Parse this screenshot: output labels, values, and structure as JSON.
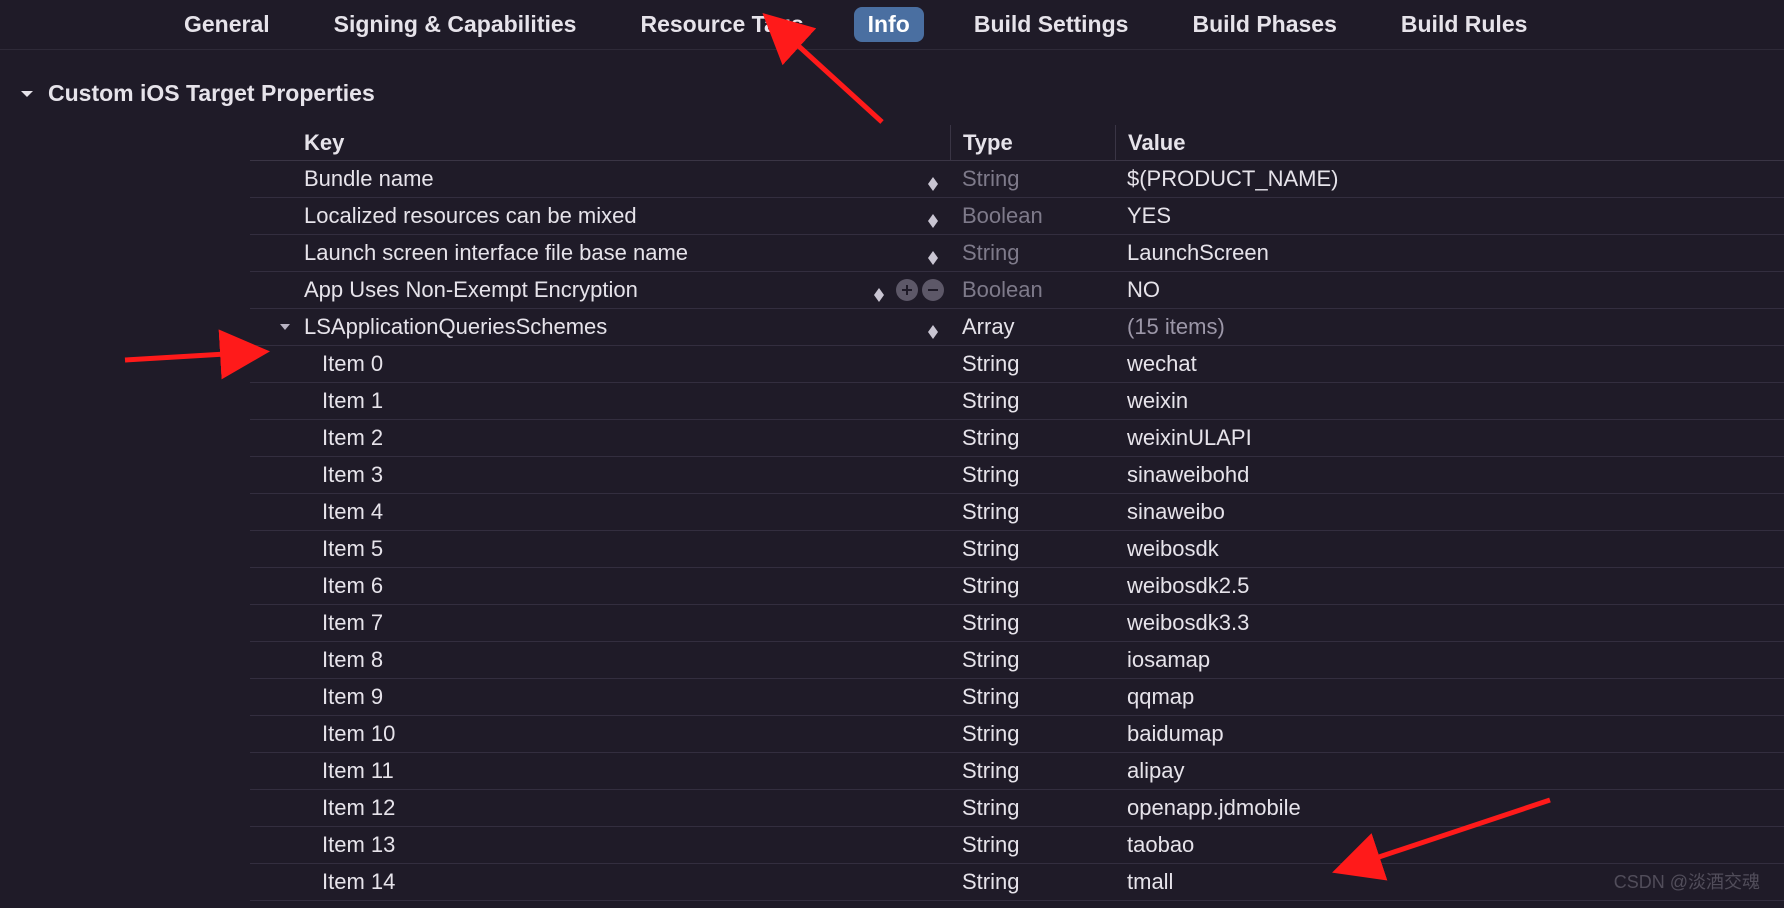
{
  "tabs": [
    {
      "label": "General"
    },
    {
      "label": "Signing & Capabilities"
    },
    {
      "label": "Resource Tags"
    },
    {
      "label": "Info",
      "active": true
    },
    {
      "label": "Build Settings"
    },
    {
      "label": "Build Phases"
    },
    {
      "label": "Build Rules"
    }
  ],
  "section": {
    "title": "Custom iOS Target Properties"
  },
  "columns": {
    "key": "Key",
    "type": "Type",
    "value": "Value"
  },
  "rows": [
    {
      "key": "Bundle name",
      "type": "String",
      "type_dim": true,
      "value": "$(PRODUCT_NAME)",
      "key_stepper": true
    },
    {
      "key": "Localized resources can be mixed",
      "type": "Boolean",
      "type_dim": true,
      "value": "YES",
      "key_stepper": true,
      "value_stepper": true
    },
    {
      "key": "Launch screen interface file base name",
      "type": "String",
      "type_dim": true,
      "value": "LaunchScreen",
      "key_stepper": true
    },
    {
      "key": "App Uses Non-Exempt Encryption",
      "type": "Boolean",
      "type_dim": true,
      "value": "NO",
      "key_stepper": true,
      "pm": true,
      "value_stepper": true
    },
    {
      "key": "LSApplicationQueriesSchemes",
      "type": "Array",
      "value": "(15 items)",
      "value_dim": true,
      "key_stepper": true,
      "disclosure": true
    }
  ],
  "items": [
    {
      "key": "Item 0",
      "type": "String",
      "value": "wechat"
    },
    {
      "key": "Item 1",
      "type": "String",
      "value": "weixin"
    },
    {
      "key": "Item 2",
      "type": "String",
      "value": "weixinULAPI"
    },
    {
      "key": "Item 3",
      "type": "String",
      "value": "sinaweibohd"
    },
    {
      "key": "Item 4",
      "type": "String",
      "value": "sinaweibo"
    },
    {
      "key": "Item 5",
      "type": "String",
      "value": "weibosdk"
    },
    {
      "key": "Item 6",
      "type": "String",
      "value": "weibosdk2.5"
    },
    {
      "key": "Item 7",
      "type": "String",
      "value": "weibosdk3.3"
    },
    {
      "key": "Item 8",
      "type": "String",
      "value": "iosamap"
    },
    {
      "key": "Item 9",
      "type": "String",
      "value": "qqmap"
    },
    {
      "key": "Item 10",
      "type": "String",
      "value": "baidumap"
    },
    {
      "key": "Item 11",
      "type": "String",
      "value": "alipay"
    },
    {
      "key": "Item 12",
      "type": "String",
      "value": "openapp.jdmobile"
    },
    {
      "key": "Item 13",
      "type": "String",
      "value": "taobao"
    },
    {
      "key": "Item 14",
      "type": "String",
      "value": "tmall"
    }
  ],
  "watermark": "CSDN @淡酒交魂"
}
